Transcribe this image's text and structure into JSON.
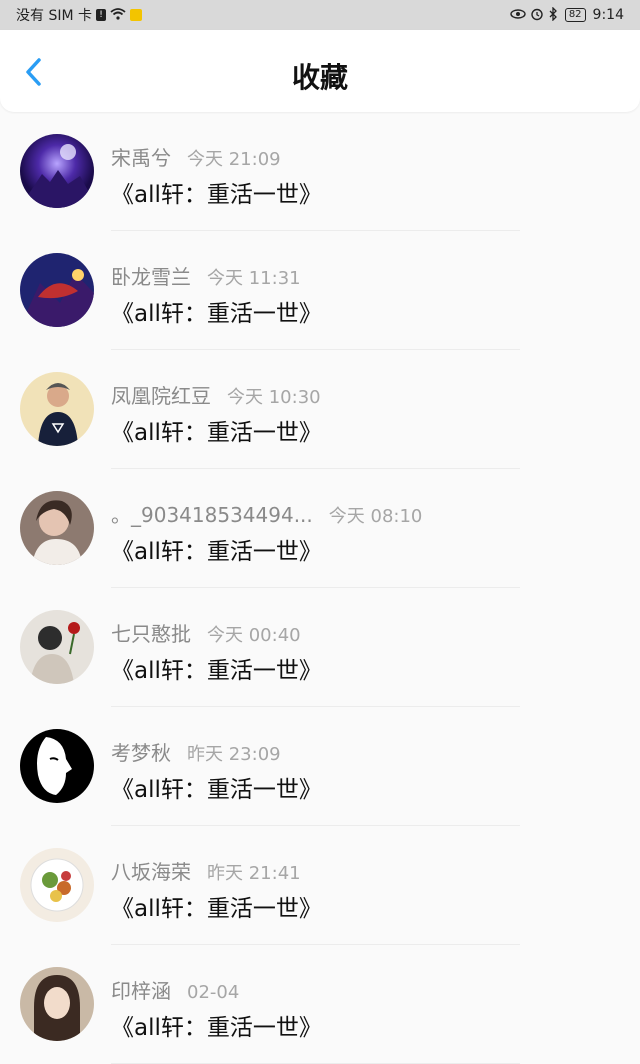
{
  "status_bar": {
    "carrier": "没有 SIM 卡",
    "battery": "82",
    "time": "9:14"
  },
  "header": {
    "back_icon": "chevron-left-icon",
    "title": "收藏"
  },
  "colors": {
    "accent": "#2a9df4",
    "name_gray": "#8a8a8a",
    "time_gray": "#a6a6a6"
  },
  "items": [
    {
      "name": "宋禹兮",
      "time": "今天 21:09",
      "content": "《all轩：重活一世》"
    },
    {
      "name": "卧龙雪兰",
      "time": "今天 11:31",
      "content": "《all轩：重活一世》"
    },
    {
      "name": "凤凰院红豆",
      "time": "今天 10:30",
      "content": "《all轩：重活一世》"
    },
    {
      "name": "。_903418534494...",
      "time": "今天 08:10",
      "content": "《all轩：重活一世》"
    },
    {
      "name": "七只憨批",
      "time": "今天 00:40",
      "content": "《all轩：重活一世》"
    },
    {
      "name": "考梦秋",
      "time": "昨天 23:09",
      "content": "《all轩：重活一世》"
    },
    {
      "name": "八坂海荣",
      "time": "昨天 21:41",
      "content": "《all轩：重活一世》"
    },
    {
      "name": "印梓涵",
      "time": "02-04",
      "content": "《all轩：重活一世》"
    }
  ]
}
